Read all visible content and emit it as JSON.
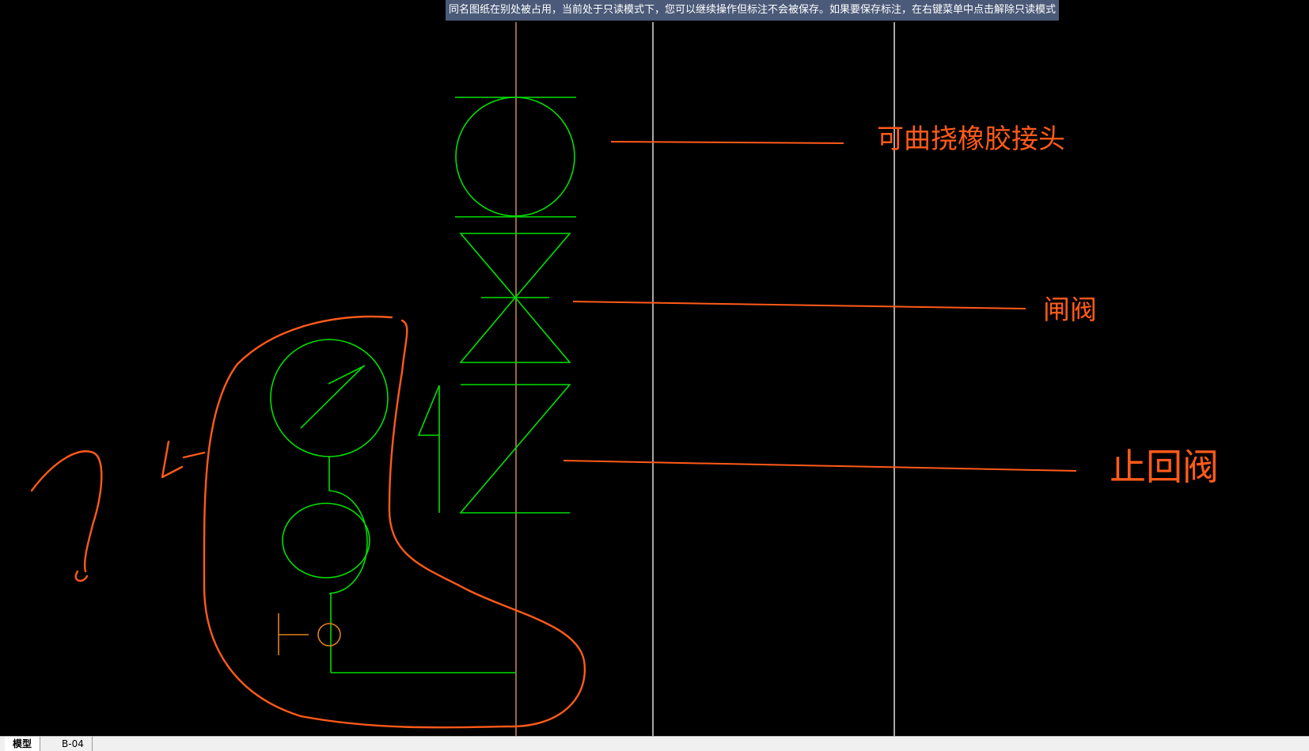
{
  "banner": {
    "message": "同名图纸在别处被占用，当前处于只读模式下，您可以继续操作但标注不会被保存。如果要保存标注，在右键菜单中点击解除只读模式"
  },
  "annotations": {
    "flex_joint": "可曲挠橡胶接头",
    "gate_valve": "闸阀",
    "check_valve": "止回阀"
  },
  "tabs": {
    "model": "模型",
    "layout": "B-04"
  },
  "colors": {
    "background": "#000000",
    "drawing_green": "#00e000",
    "markup_orange": "#ff5a1a",
    "grid_white": "#ffffff",
    "banner_bg": "#4a5a78"
  }
}
